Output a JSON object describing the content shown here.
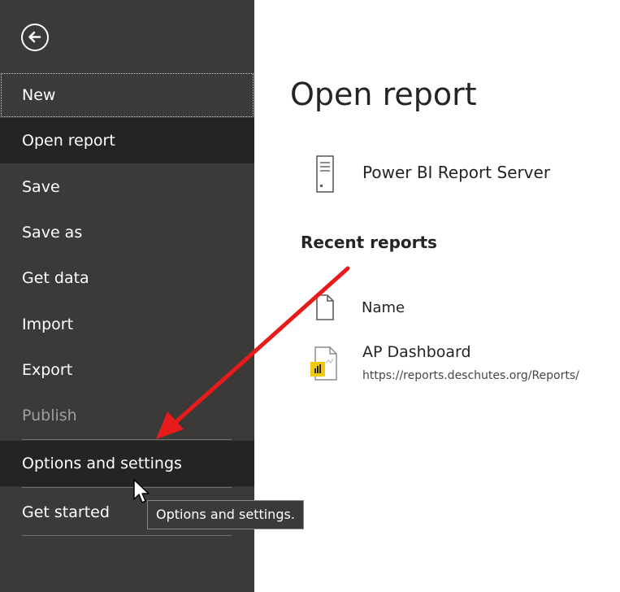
{
  "sidebar": {
    "back": {
      "icon": "back-arrow-icon"
    },
    "items": [
      {
        "label": "New"
      },
      {
        "label": "Open report"
      },
      {
        "label": "Save"
      },
      {
        "label": "Save as"
      },
      {
        "label": "Get data"
      },
      {
        "label": "Import"
      },
      {
        "label": "Export"
      },
      {
        "label": "Publish"
      },
      {
        "label": "Options and settings"
      },
      {
        "label": "Get started"
      }
    ]
  },
  "main": {
    "title": "Open report",
    "server": {
      "label": "Power BI Report Server",
      "icon": "server-icon"
    },
    "recent": {
      "title": "Recent reports",
      "column_name": "Name",
      "reports": [
        {
          "name": "AP Dashboard",
          "url": "https://reports.deschutes.org/Reports/",
          "icon": "pbix-file-icon"
        }
      ]
    }
  },
  "tooltip": {
    "text": "Options and settings."
  },
  "colors": {
    "sidebar_bg": "#3b3a39",
    "sidebar_selected": "#252423",
    "disabled_text": "#a19f9d",
    "annotation_arrow": "#e81b1b",
    "file_badge": "#f2c811"
  }
}
